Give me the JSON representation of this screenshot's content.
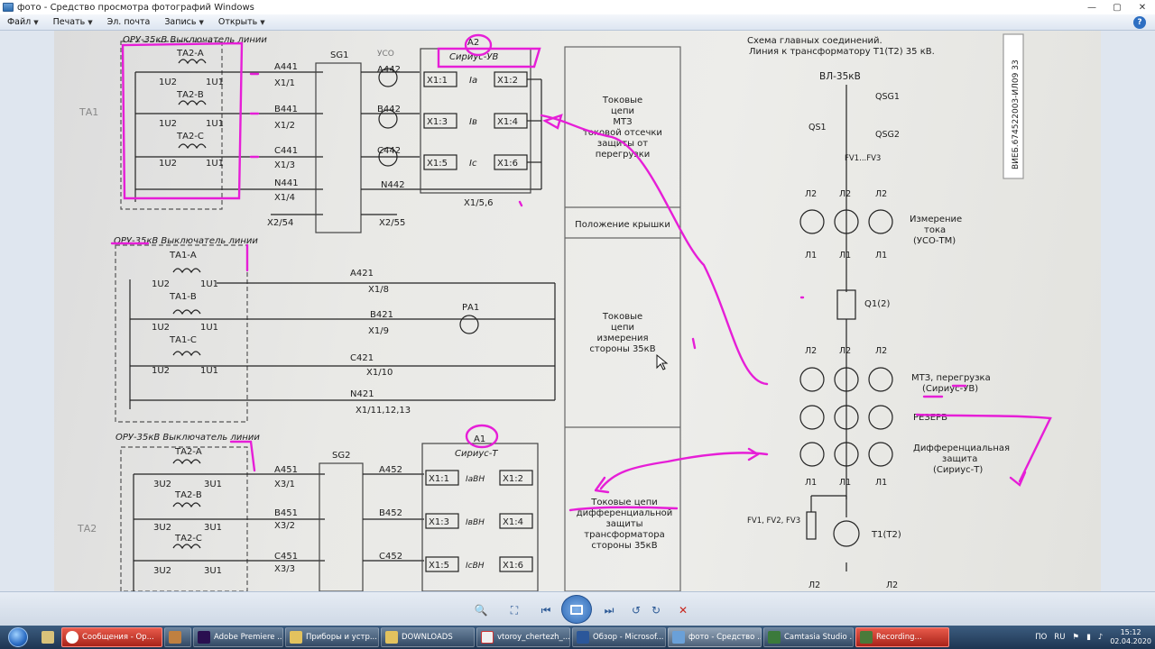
{
  "window": {
    "title": "фото - Средство просмотра фотографий Windows"
  },
  "menu": {
    "items": [
      "Файл",
      "Печать",
      "Эл. почта",
      "Запись",
      "Открыть"
    ],
    "help": "?"
  },
  "diagram": {
    "header_left_1": "ОРУ-35кВ Выключатель линии",
    "header_left_2": "ОРУ-35кВ Выключатель линии",
    "header_left_3": "ОРУ-35кВ Выключатель линии",
    "title_line1": "Схема главных соединений.",
    "title_line2": "Линия к трансформатору Т1(Т2) 35 кВ.",
    "sg1": "SG1",
    "sg2": "SG2",
    "a2": "А2",
    "a2_device": "Сириус-УВ",
    "a1": "А1",
    "a1_device": "Сириус-Т",
    "uso": "УСО",
    "stamp": "ВИЕБ.674522003-ИЛ09 33",
    "ta2a": "ТА2-А",
    "ta2b": "ТА2-В",
    "ta2c": "ТА2-С",
    "ta1a": "ТА1-А",
    "ta1b": "ТА1-В",
    "ta1c": "ТА1-С",
    "ta1_side": "ТА1",
    "ta2_side": "ТА2",
    "1u2": "1U2",
    "1u1": "1U1",
    "3u2": "3U2",
    "3u1": "3U1",
    "a441": "А441",
    "b441": "В441",
    "c441": "С441",
    "n441": "N441",
    "a442": "А442",
    "b442": "В442",
    "c442": "С442",
    "n442": "N442",
    "x1_1": "Х1/1",
    "x1_2": "Х1/2",
    "x1_3": "Х1/3",
    "x1_4": "Х1/4",
    "x2_54": "Х2/54",
    "x2_55": "Х2/55",
    "x1_56": "Х1/5,6",
    "a421": "А421",
    "b421": "В421",
    "c421": "С421",
    "n421": "N421",
    "x1_8": "Х1/8",
    "x1_9": "Х1/9",
    "x1_10": "Х1/10",
    "x1_1113": "Х1/11,12,13",
    "pa1": "РА1",
    "a451": "А451",
    "b451": "В451",
    "c451": "С451",
    "a452": "А452",
    "b452": "В452",
    "c452": "С452",
    "x3_1": "Х3/1",
    "x3_2": "Х3/2",
    "x3_3": "Х3/3",
    "blk_x11": "Х1:1",
    "blk_x12": "Х1:2",
    "blk_x13": "Х1:3",
    "blk_x14": "Х1:4",
    "blk_x15": "Х1:5",
    "blk_x16": "Х1:6",
    "ia": "Iа",
    "ib": "Iв",
    "ic": "Iс",
    "iavn": "IаВН",
    "ibvn": "IвВН",
    "icvn": "IсВН",
    "panel1": [
      "Токовые",
      "цепи",
      "МТЗ",
      "токовой отсечки",
      "защиты от",
      "перегрузки"
    ],
    "panel_header": "Положение крышки",
    "panel2": [
      "Токовые",
      "цепи",
      "измерения",
      "стороны 35кВ"
    ],
    "panel3": [
      "Токовые цепи",
      "дифференциальной",
      "защиты",
      "трансформатора",
      "стороны 35кВ"
    ],
    "vl": "ВЛ-35кВ",
    "qsg1": "QSG1",
    "qsg2": "QSG2",
    "qs1": "QS1",
    "fv13": "FV1...FV3",
    "l2": "Л2",
    "l1": "Л1",
    "measure": [
      "Измерение",
      "тока",
      "(УСО-ТМ)"
    ],
    "q1": "Q1(2)",
    "mtz": [
      "МТЗ, перегрузка",
      "(Сириус-УВ)"
    ],
    "reserve": "РЕЗЕРВ",
    "diff": [
      "Дифференциальная",
      "защита",
      "(Сириус-Т)"
    ],
    "fv123": "FV1, FV2, FV3",
    "t1": "Т1(Т2)"
  },
  "taskbar": {
    "tasks": [
      "Сообщения - Op...",
      "",
      "Adobe Premiere ...",
      "Приборы и устр...",
      "DOWNLOADS",
      "vtoroy_chertezh_...",
      "Обзор - Microsof...",
      "фото - Средство ...",
      "Camtasia Studio ...",
      "Recording..."
    ],
    "lang": "ПО",
    "layout": "RU",
    "time": "15:12",
    "date": "02.04.2020"
  },
  "colors": {
    "annotation": "#e61ed7",
    "taskbar": "#23405f",
    "toolbar_blue": "#2c67b4"
  }
}
